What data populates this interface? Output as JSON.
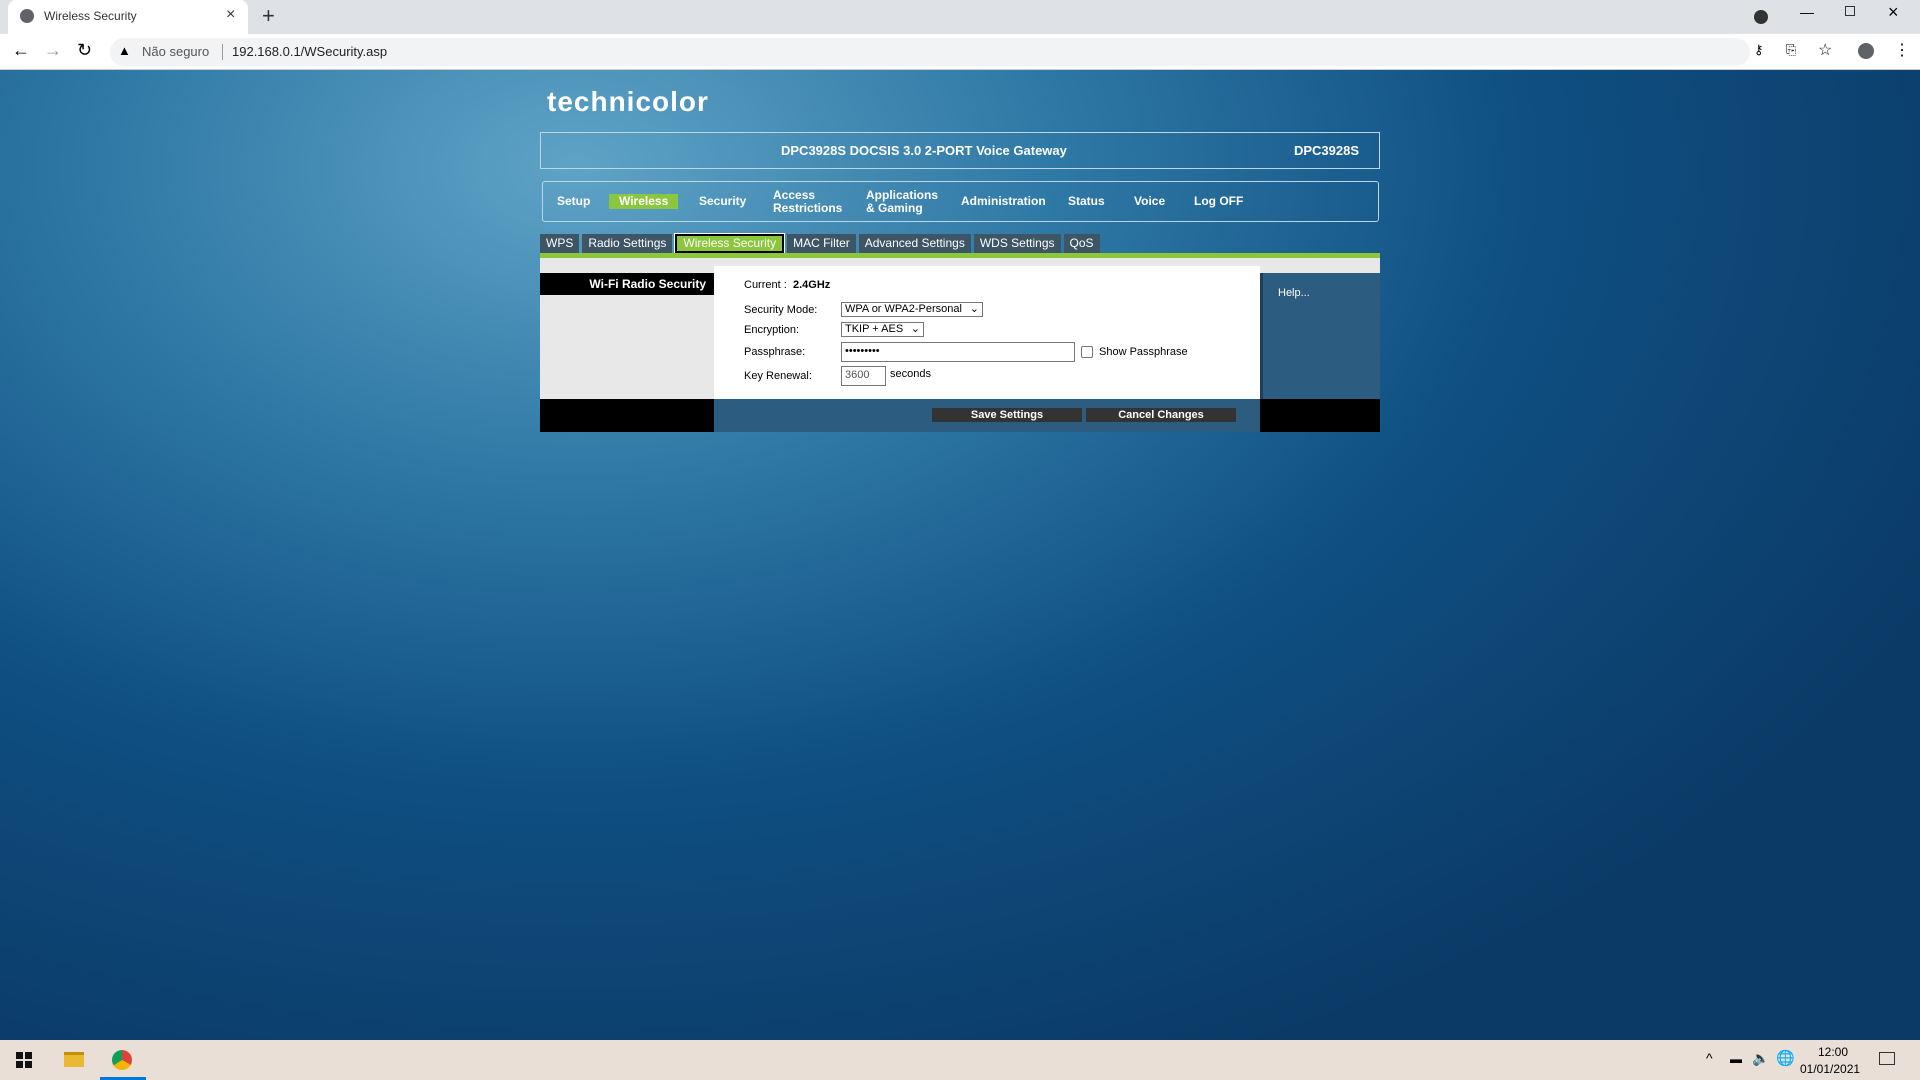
{
  "browser": {
    "tab_title": "Wireless Security",
    "security_label": "Não seguro",
    "url": "192.168.0.1/WSecurity.asp"
  },
  "router": {
    "logo": "technicolor",
    "title": "DPC3928S DOCSIS 3.0 2-PORT Voice Gateway",
    "model": "DPC3928S",
    "nav": [
      {
        "label": "Setup"
      },
      {
        "label": "Wireless",
        "active": true
      },
      {
        "label": "Security"
      },
      {
        "label": "Access Restrictions"
      },
      {
        "label": "Applications & Gaming"
      },
      {
        "label": "Administration"
      },
      {
        "label": "Status"
      },
      {
        "label": "Voice"
      },
      {
        "label": "Log OFF"
      }
    ],
    "subtabs": [
      {
        "label": "WPS"
      },
      {
        "label": "Radio Settings"
      },
      {
        "label": "Wireless Security",
        "active": true
      },
      {
        "label": "MAC Filter"
      },
      {
        "label": "Advanced Settings"
      },
      {
        "label": "WDS Settings"
      },
      {
        "label": "QoS"
      }
    ],
    "accent": "#8cc63f",
    "section": "Wi-Fi Radio Security",
    "form": {
      "current_label": "Current :",
      "current_value": "2.4GHz",
      "security_mode_label": "Security Mode:",
      "security_mode": "WPA or WPA2-Personal",
      "encryption_label": "Encryption:",
      "encryption": "TKIP + AES",
      "passphrase_label": "Passphrase:",
      "passphrase": "•••••••••",
      "show_passphrase": "Show Passphrase",
      "key_renewal_label": "Key Renewal:",
      "key_renewal": "3600",
      "seconds": "seconds"
    },
    "help": "Help...",
    "save": "Save Settings",
    "cancel": "Cancel Changes"
  },
  "taskbar": {
    "time": "12:00",
    "date": "01/01/2021"
  }
}
